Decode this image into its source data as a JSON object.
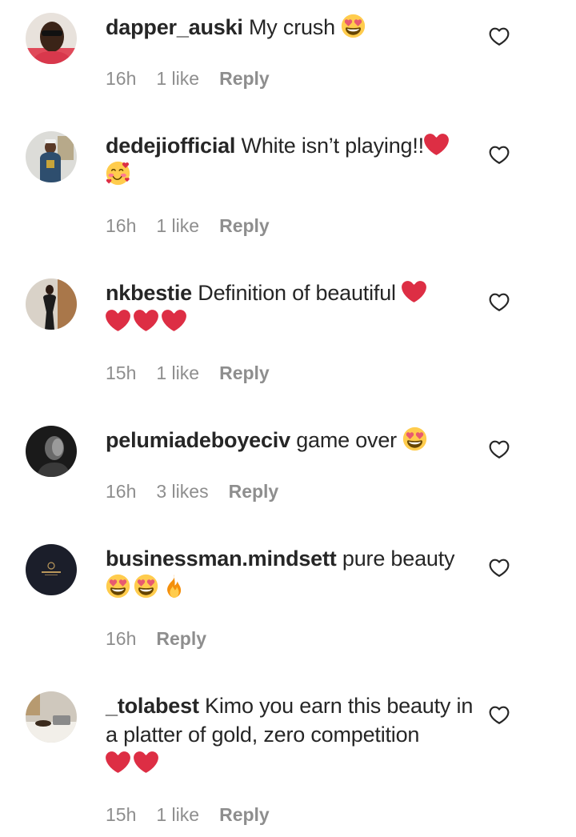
{
  "reply_label": "Reply",
  "comments": [
    {
      "username": "dapper_auski",
      "text": "My crush",
      "time": "16h",
      "likes": "1 like"
    },
    {
      "username": "dedejiofficial",
      "text": "White isn’t playing!!",
      "time": "16h",
      "likes": "1 like"
    },
    {
      "username": "nkbestie",
      "text": "Definition of beautiful",
      "time": "15h",
      "likes": "1 like"
    },
    {
      "username": "pelumiadeboyeciv",
      "text": "game over",
      "time": "16h",
      "likes": "3 likes"
    },
    {
      "username": "businessman.mindsett",
      "text": "pure beauty",
      "time": "16h",
      "likes": ""
    },
    {
      "username": "_tolabest",
      "text": "Kimo you earn this beauty in a platter of gold, zero competition",
      "time": "15h",
      "likes": "1 like"
    }
  ],
  "icons": {
    "like": "heart-outline-icon",
    "heart_eyes": "heart-eyes-emoji",
    "red_heart": "red-heart-emoji",
    "smiling_hearts": "smiling-face-with-hearts-emoji",
    "fire": "fire-emoji"
  },
  "colors": {
    "text": "#262626",
    "meta": "#8e8e8e",
    "heart": "#dd2e44"
  }
}
